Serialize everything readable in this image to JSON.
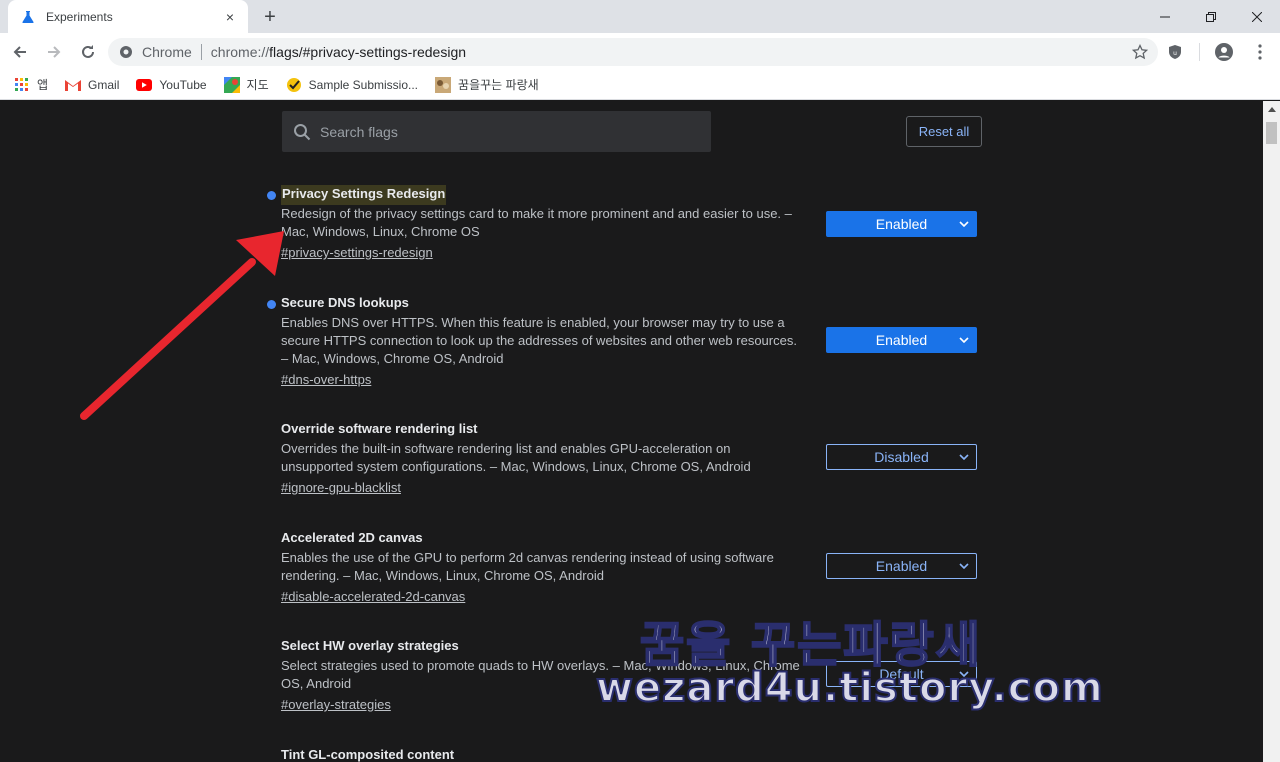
{
  "tab": {
    "title": "Experiments",
    "close_icon": "×"
  },
  "newtab": {
    "icon": "+"
  },
  "window": {
    "minimize": "—",
    "restore": "❐",
    "close": "✕"
  },
  "omnibox": {
    "site_label": "Chrome",
    "url_prefix": "chrome://",
    "url_rest": "flags/#privacy-settings-redesign"
  },
  "bookmarks": [
    {
      "label": "앱",
      "icon": "apps-grid-icon"
    },
    {
      "label": "Gmail",
      "icon": "gmail-icon"
    },
    {
      "label": "YouTube",
      "icon": "youtube-icon"
    },
    {
      "label": "지도",
      "icon": "maps-icon"
    },
    {
      "label": "Sample Submissio...",
      "icon": "checkmark-icon"
    },
    {
      "label": "꿈을꾸는 파랑새",
      "icon": "site-thumbnail-icon"
    }
  ],
  "search": {
    "placeholder": "Search flags"
  },
  "reset_button": "Reset all",
  "flags": [
    {
      "title": "Privacy Settings Redesign",
      "desc": "Redesign of the privacy settings card to make it more prominent and and easier to use. – Mac, Windows, Linux, Chrome OS",
      "link": "#privacy-settings-redesign",
      "state": "Enabled",
      "modified": true
    },
    {
      "title": "Secure DNS lookups",
      "desc": "Enables DNS over HTTPS. When this feature is enabled, your browser may try to use a secure HTTPS connection to look up the addresses of websites and other web resources. – Mac, Windows, Chrome OS, Android",
      "link": "#dns-over-https",
      "state": "Enabled",
      "modified": true
    },
    {
      "title": "Override software rendering list",
      "desc": "Overrides the built-in software rendering list and enables GPU-acceleration on unsupported system configurations. – Mac, Windows, Linux, Chrome OS, Android",
      "link": "#ignore-gpu-blacklist",
      "state": "Disabled",
      "modified": false
    },
    {
      "title": "Accelerated 2D canvas",
      "desc": "Enables the use of the GPU to perform 2d canvas rendering instead of using software rendering. – Mac, Windows, Linux, Chrome OS, Android",
      "link": "#disable-accelerated-2d-canvas",
      "state": "Enabled",
      "modified": false
    },
    {
      "title": "Select HW overlay strategies",
      "desc": "Select strategies used to promote quads to HW overlays. – Mac, Windows, Linux, Chrome OS, Android",
      "link": "#overlay-strategies",
      "state": "Default",
      "modified": false
    },
    {
      "title": "Tint GL-composited content",
      "desc": "",
      "link": "",
      "state": "",
      "modified": false
    }
  ],
  "watermark": {
    "korean": "꿈을 꾸는파랑새",
    "url": "wezard4u.tistory.com"
  },
  "colors": {
    "accent": "#1a73e8",
    "link_blue": "#8ab4f8",
    "dot_blue": "#4285f4",
    "arrow_red": "#e8262e"
  }
}
